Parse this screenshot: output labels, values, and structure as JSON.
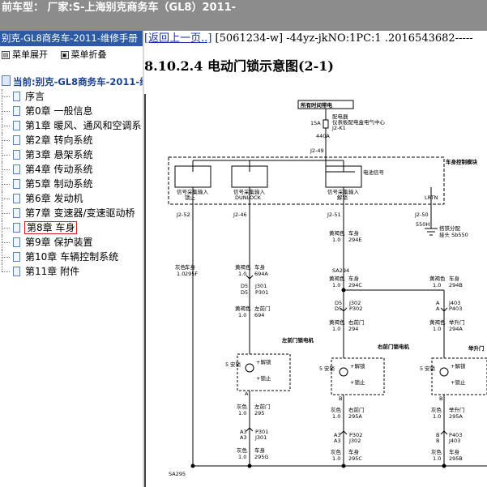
{
  "titlebar": {
    "text": "前车型： 厂家:S-上海别克商务车（GL8）2011-"
  },
  "sidebar": {
    "manual_title": "别克-GL8商务车-2011-维修手册",
    "expand_label": "菜单展开",
    "collapse_label": "菜单折叠",
    "root_label": "当前:别克-GL8商务车-2011-维",
    "items": [
      {
        "label": "序言"
      },
      {
        "label": "第0章 一般信息"
      },
      {
        "label": "第1章 暖风、通风和空调系"
      },
      {
        "label": "第2章 转向系统"
      },
      {
        "label": "第3章 悬架系统"
      },
      {
        "label": "第4章 传动系统"
      },
      {
        "label": "第5章 制动系统"
      },
      {
        "label": "第6章 发动机"
      },
      {
        "label": "第7章 变速器/变速驱动桥"
      },
      {
        "label": "第8章 车身"
      },
      {
        "label": "第9章 保护装置"
      },
      {
        "label": "第10章 车辆控制系统"
      },
      {
        "label": "第11章 附件"
      }
    ],
    "selected_index": 9
  },
  "content": {
    "back_link": "[返回上一页..]",
    "doc_id": " [5061234-w] -44yz-jkNO:1PC:1 .2016543682-----",
    "heading": "8.10.2.4 电动门锁示意图(2-1)"
  },
  "schematic": {
    "hot_at_all_times": "所有时间带电",
    "fuse": "15A",
    "fuse_desc_1": "配电器",
    "fuse_desc_2": "仪表板配电盒电气中心",
    "fuse_pin": "J2-K1",
    "wire_440a": "440A",
    "j2_49": "J2-49",
    "power_supply": "电池信号",
    "bcm": "车身控制模块",
    "signal_1": "信号采集输入",
    "signal_1b": "锁止",
    "signal_2": "信号采集输入",
    "signal_2b": "DUNLOCK",
    "signal_3": "信号采集输入",
    "signal_3b": "解锁",
    "lrtn": "LRTN",
    "pin_j2_52": "J2-52",
    "pin_j2_46": "J2-46",
    "pin_j2_51": "J2-51",
    "pin_j2_50": "J2-50",
    "wire_550h": "550H",
    "ground_label_1": "搭铁分配",
    "ground_label_2": "接头 Sb550",
    "col1_color": "灰色",
    "col1_body": "车身",
    "col1_size": "1.0",
    "col1_circuit": "295F",
    "col2_color": "黄褐色",
    "col2_body": "车身",
    "col2_size": "1.0",
    "col2_circuit": "694A",
    "col3_color": "黄褐色",
    "col3_body": "车身",
    "col3_size": "1.0",
    "col3_circuit": "294E",
    "col2_d5": "D5",
    "col2_d5b": "D5",
    "col2_j301": "J301",
    "col2_p301": "P301",
    "col2_color2": "黄褐色",
    "col2_door": "左前门",
    "col2_size2": "1.0",
    "col2_circuit2": "694",
    "left_lock": "左前门锁电机",
    "unlock": "+解锁",
    "lock": "+锁止",
    "relay_5": "5",
    "relay_body": "安锁",
    "sa294": "SA294",
    "col3_color2": "黄褐色",
    "col3_body2": "车身",
    "col3_size2": "1.0",
    "col3_circuit2": "294C",
    "col3_d5": "D5",
    "col3_d5b": "D5",
    "col3_j302": "J302",
    "col3_p302": "P302",
    "col3_color3": "黄褐色",
    "col3_door": "右前门",
    "col3_size3": "1.0",
    "col3_circuit3": "294",
    "right_lock": "右前门锁电机",
    "col4_color": "黄褐色",
    "col4_body": "车身",
    "col4_size": "1.0",
    "col4_circuit": "294B",
    "col4_a": "A",
    "col4_a2": "A",
    "col4_j403": "J403",
    "col4_p403": "P403",
    "col4_color2": "黄褐色",
    "col4_door": "举升门",
    "col4_size2": "1.0",
    "col4_circuit2": "294A",
    "liftgate_lock": "举升门",
    "col2_color3": "灰色",
    "col2_door3": "左前门",
    "col2_size3": "1.0",
    "col2_circuit3": "295",
    "col2_a3": "A3",
    "col2_a3b": "A3",
    "col2_p301b": "P301",
    "col2_j301b": "J301",
    "col2_color4": "灰色",
    "col2_body4": "车身",
    "col2_size4": "1.0",
    "col2_circuit4": "295G",
    "col3_color4": "灰色",
    "col3_door4": "右前门",
    "col3_size4": "1.0",
    "col3_circuit4": "295A",
    "col3_a3": "A3",
    "col3_a3b": "A3",
    "col3_p302b": "P302",
    "col3_j302b": "J302",
    "col3_color5": "灰色",
    "col3_body5": "车身",
    "col3_size5": "1.0",
    "col3_circuit5": "295C",
    "col4_color3": "灰色",
    "col4_door3": "举升门",
    "col4_size3": "1.0",
    "col4_circuit3": "295A",
    "col4_b": "B",
    "col4_b2": "B",
    "col4_p403b": "P403",
    "col4_j403b": "J403",
    "col4_color4": "灰色",
    "col4_body4": "车身",
    "col4_size4": "1.0",
    "col4_circuit4": "295B",
    "sa295": "SA295",
    "pin_a": "A",
    "pin_b": "B"
  }
}
